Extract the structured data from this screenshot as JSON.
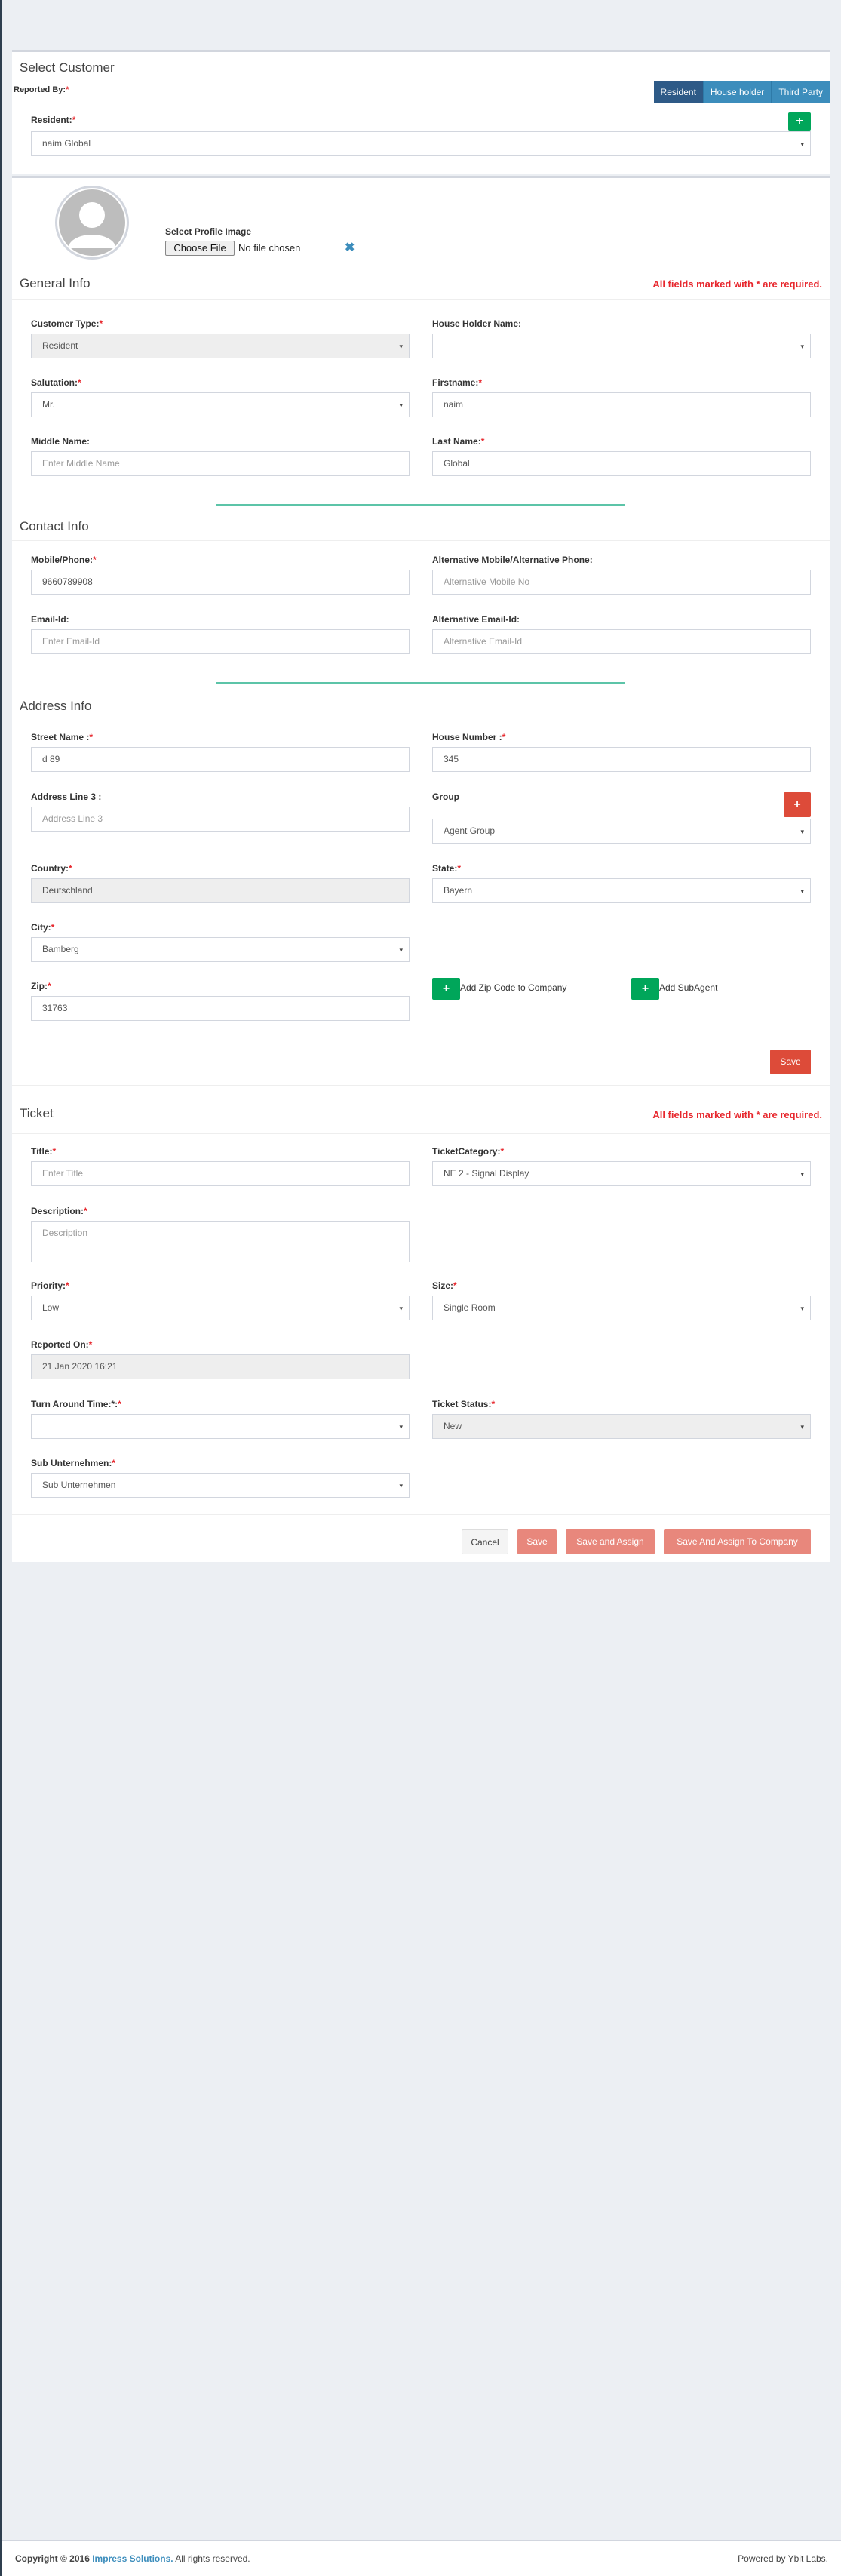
{
  "select_customer": {
    "title": "Select Customer",
    "reported_by_label": "Reported By:",
    "tabs": [
      {
        "label": "Resident",
        "active": true
      },
      {
        "label": "House holder",
        "active": false
      },
      {
        "label": "Third Party",
        "active": false
      }
    ],
    "resident_label": "Resident:",
    "resident_value": "naim Global",
    "add_icon": "plus-icon"
  },
  "profile": {
    "select_image_label": "Select Profile Image",
    "choose_file_label": "Choose File",
    "no_file_text": "No file chosen",
    "remove_icon": "x-icon"
  },
  "general_info": {
    "title": "General Info",
    "required_note": "All fields marked with * are required.",
    "customer_type_label": "Customer Type:",
    "customer_type_value": "Resident",
    "house_holder_label": "House Holder Name:",
    "house_holder_value": "",
    "salutation_label": "Salutation:",
    "salutation_value": "Mr.",
    "firstname_label": "Firstname:",
    "firstname_value": "naim",
    "middle_name_label": "Middle Name:",
    "middle_name_placeholder": "Enter Middle Name",
    "last_name_label": "Last Name:",
    "last_name_value": "Global"
  },
  "contact_info": {
    "title": "Contact Info",
    "mobile_label": "Mobile/Phone:",
    "mobile_value": "9660789908",
    "alt_mobile_label": "Alternative Mobile/Alternative Phone:",
    "alt_mobile_placeholder": "Alternative Mobile No",
    "email_label": "Email-Id:",
    "email_placeholder": "Enter Email-Id",
    "alt_email_label": "Alternative Email-Id:",
    "alt_email_placeholder": "Alternative Email-Id"
  },
  "address_info": {
    "title": "Address Info",
    "street_label": "Street Name :",
    "street_value": "d 89",
    "house_number_label": "House Number :",
    "house_number_value": "345",
    "address3_label": "Address Line 3 :",
    "address3_placeholder": "Address Line 3",
    "group_label": "Group",
    "group_value": "Agent Group",
    "country_label": "Country:",
    "country_value": "Deutschland",
    "state_label": "State:",
    "state_value": "Bayern",
    "city_label": "City:",
    "city_value": "Bamberg",
    "zip_label": "Zip:",
    "zip_value": "31763",
    "add_zip_label": "Add Zip Code to Company",
    "add_subagent_label": "Add SubAgent",
    "save_label": "Save"
  },
  "ticket": {
    "title": "Ticket",
    "required_note": "All fields marked with * are required.",
    "title_label": "Title:",
    "title_placeholder": "Enter Title",
    "category_label": "TicketCategory:",
    "category_value": "NE 2 - Signal Display",
    "description_label": "Description:",
    "description_placeholder": "Description",
    "priority_label": "Priority:",
    "priority_value": "Low",
    "size_label": "Size:",
    "size_value": "Single Room",
    "reported_on_label": "Reported On:",
    "reported_on_value": "21 Jan 2020 16:21",
    "turnaround_label": "Turn Around Time:*:",
    "turnaround_value": "",
    "status_label": "Ticket Status:",
    "status_value": "New",
    "sub_unternehmen_label": "Sub Unternehmen:",
    "sub_unternehmen_value": "Sub Unternehmen",
    "cancel_label": "Cancel",
    "save_label": "Save",
    "save_assign_label": "Save and Assign",
    "save_assign_company_label": "Save And Assign To Company"
  },
  "footer": {
    "copyright_prefix": "Copyright © 2016",
    "company": "Impress Solutions.",
    "rights": "All rights reserved.",
    "powered": "Powered by Ybit Labs."
  },
  "colors": {
    "accent": "#3c8dbc",
    "tab_active": "#2e5a87",
    "success": "#00a65a",
    "danger": "#dd4b39",
    "required": "#e7272d"
  }
}
